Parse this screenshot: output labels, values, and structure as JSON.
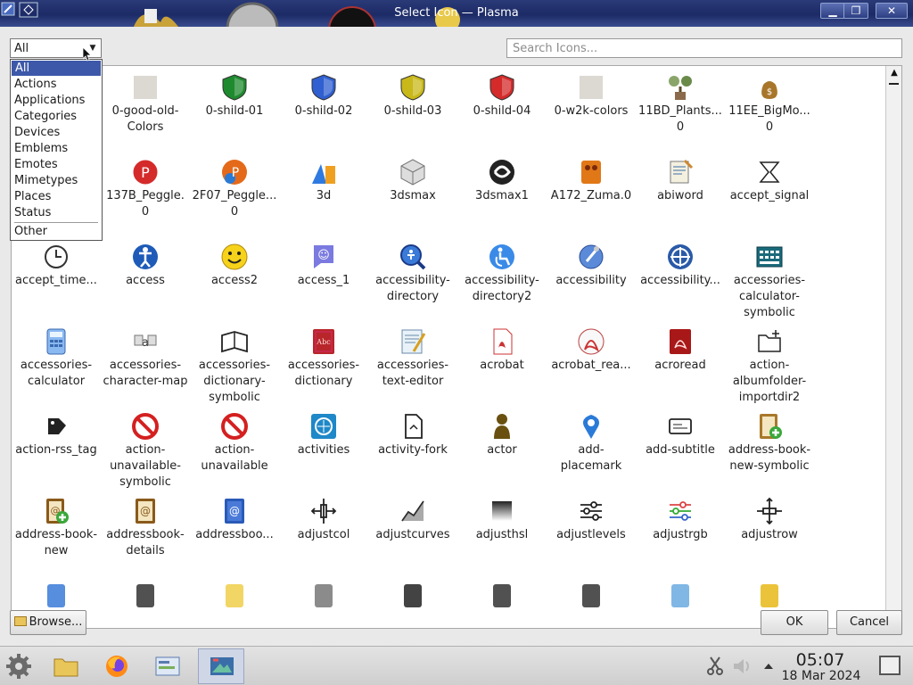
{
  "window": {
    "title": "Select Icon — Plasma"
  },
  "category": {
    "selected": "All",
    "options": [
      "All",
      "Actions",
      "Applications",
      "Categories",
      "Devices",
      "Emblems",
      "Emotes",
      "Mimetypes",
      "Places",
      "Status",
      "Other"
    ]
  },
  "search": {
    "placeholder": "Search Icons..."
  },
  "icons": [
    [
      "0-good-old-Colors",
      "0-shild-01",
      "0-shild-02",
      "0-shild-03",
      "0-shild-04",
      "0-w2k-colors",
      "11BD_Plants... 0",
      "11EE_BigMo... 0"
    ],
    [
      "137B_Peggle. 0",
      "2F07_Peggle... 0",
      "3d",
      "3dsmax",
      "3dsmax1",
      "A172_Zuma.0",
      "abiword",
      "accept_signal"
    ],
    [
      "accept_time...",
      "access",
      "access2",
      "access_1",
      "accessibility-directory",
      "accessibility-directory2",
      "accessibility",
      "accessibility...",
      "accessories-calculator-symbolic"
    ],
    [
      "accessories-calculator",
      "accessories-character-map",
      "accessories-dictionary-symbolic",
      "accessories-dictionary",
      "accessories-text-editor",
      "acrobat",
      "acrobat_rea...",
      "acroread",
      "action-albumfolder-importdir2"
    ],
    [
      "action-rss_tag",
      "action-unavailable-symbolic",
      "action-unavailable",
      "activities",
      "activity-fork",
      "actor",
      "add-placemark",
      "add-subtitle",
      "address-book-new-symbolic"
    ],
    [
      "address-book-new",
      "addressbook-details",
      "addressboo...",
      "adjustcol",
      "adjustcurves",
      "adjusthsl",
      "adjustlevels",
      "adjustrgb",
      "adjustrow"
    ]
  ],
  "buttons": {
    "browse": "Browse...",
    "ok": "OK",
    "cancel": "Cancel"
  },
  "taskbar": {
    "time": "05:07",
    "date": "18 Mar 2024"
  }
}
